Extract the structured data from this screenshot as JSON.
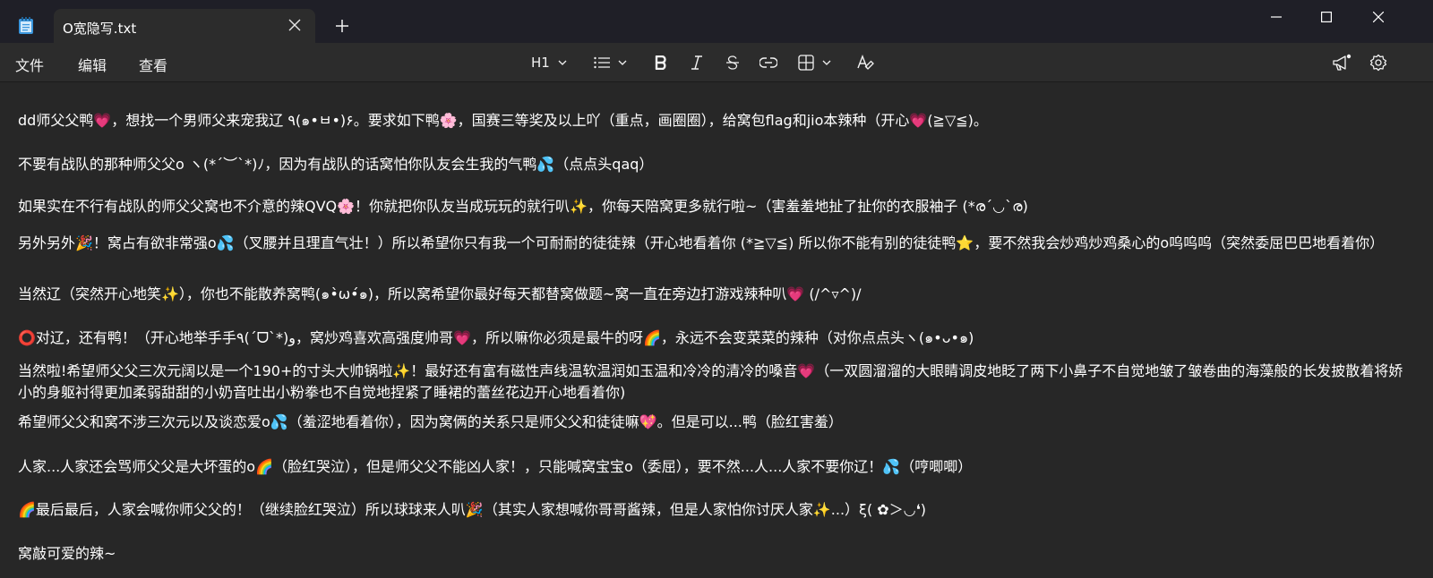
{
  "window": {
    "tab_title": "O宽隐写.txt",
    "tab_close_icon": "close-icon",
    "new_tab_icon": "plus-icon",
    "minimize_icon": "minimize-icon",
    "maximize_icon": "maximize-icon",
    "close_icon": "close-icon"
  },
  "menu": {
    "file": "文件",
    "edit": "编辑",
    "view": "查看"
  },
  "toolbar": {
    "heading_label": "H1",
    "list_icon": "bulleted-list-icon",
    "bold_icon": "bold-icon",
    "italic_icon": "italic-icon",
    "strikethrough_icon": "strikethrough-icon",
    "link_icon": "link-icon",
    "table_icon": "table-icon",
    "clear_formatting_icon": "clear-formatting-icon",
    "feedback_icon": "megaphone-icon",
    "settings_icon": "gear-icon"
  },
  "colors": {
    "titlebar": "#1f1f27",
    "toolbar": "#2c2c2c",
    "editor_background": "#272727",
    "text": "#ffffff"
  },
  "document": {
    "lines": [
      "dd师父父鸭💗，想找一个男师父来宠我辽 ٩(๑•ㅂ•)۶。要求如下鸭🌸，国赛三等奖及以上吖（重点，画圈圈），给窝包flag和jio本辣种（开心💗(≧▽≦)。",
      "不要有战队的那种师父父o ヽ(*´︶`*)ﾉ，因为有战队的话窝怕你队友会生我的气鸭💦（点点头qaq）",
      "如果实在不行有战队的师父父窝也不介意的辣QVQ🌸！你就把你队友当成玩玩的就行叭✨，你每天陪窝更多就行啦~（害羞羞地扯了扯你的衣服袖子 (*ര´◡`ര)",
      "另外另外🎉！窝占有欲非常强o💦（叉腰并且理直气壮！）所以希望你只有我一个可耐耐的徒徒辣（开心地看着你 (*≧▽≦) 所以你不能有别的徒徒鸭⭐，要不然我会炒鸡炒鸡桑心的o呜呜呜（突然委屈巴巴地看着你）",
      "当然辽（突然开心地笑✨），你也不能散养窝鸭(๑•̀ω•́๑)，所以窝希望你最好每天都替窝做题~窝一直在旁边打游戏辣种叭💗 (/^▿^)/",
      "⭕对辽，还有鸭！（开心地举手手٩(´ᗜ`*)و，窝炒鸡喜欢高强度帅哥💗，所以嘛你必须是最牛的呀🌈，永远不会变菜菜的辣种（对你点点头ヽ(๑•ᴗ•๑)",
      "当然啦!希望师父父三次元阔以是一个190+的寸头大帅锅啦✨！最好还有富有磁性声线温软温润如玉温和冷冷的清冷的嗓音💗（一双圆溜溜的大眼睛调皮地眨了两下小鼻子不自觉地皱了皱卷曲的海藻般的长发披散着将娇小的身躯衬得更加柔弱甜甜的小奶音吐出小粉拳也不自觉地捏紧了睡裙的蕾丝花边开心地看着你)",
      "希望师父父和窝不涉三次元以及谈恋爱o💦（羞涩地看着你），因为窝俩的关系只是师父父和徒徒嘛💖。但是可以...鸭（脸红害羞）",
      "人家...人家还会骂师父父是大坏蛋的o🌈（脸红哭泣），但是师父父不能凶人家！，只能喊窝宝宝o（委屈），要不然...人...人家不要你辽！💦（哼唧唧）",
      "🌈最后最后，人家会喊你师父父的！（继续脸红哭泣）所以球球来人叭🎉（其实人家想喊你哥哥酱辣，但是人家怕你讨厌人家✨...）ξ( ✿＞◡❛)",
      "窝敲可爱的辣~"
    ]
  }
}
